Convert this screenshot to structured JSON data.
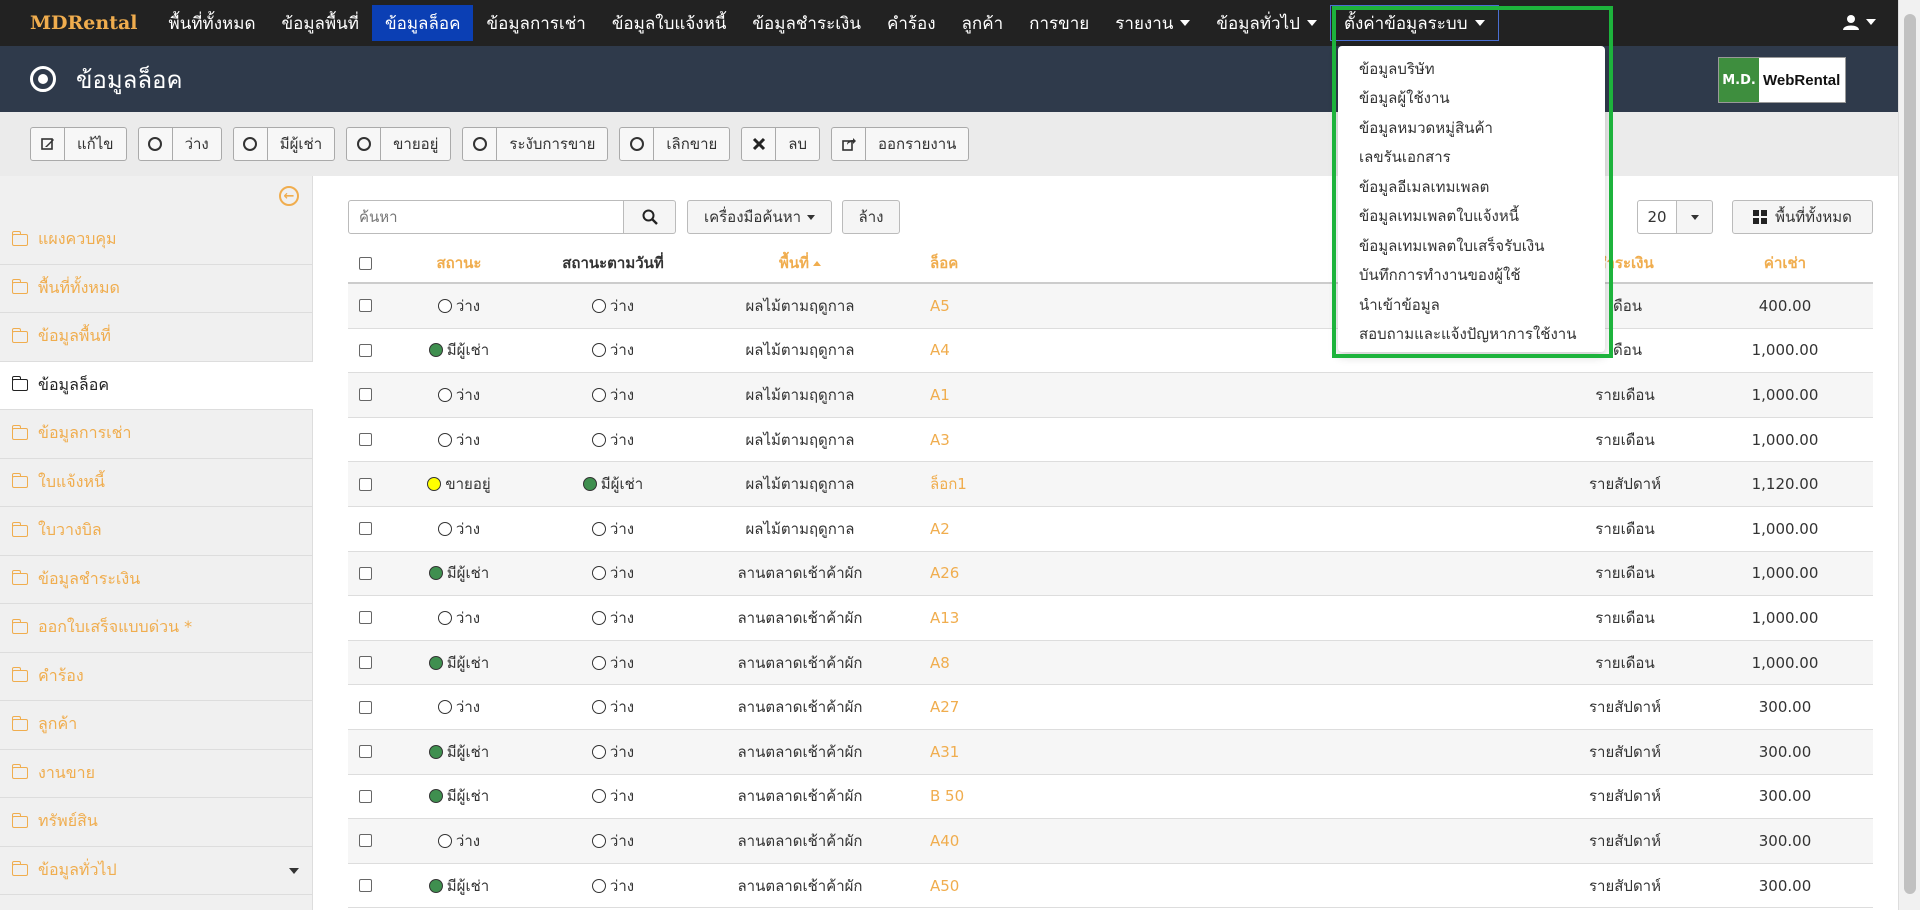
{
  "brand": "MDRental",
  "nav": [
    {
      "label": "พื้นที่ทั้งหมด",
      "dropdown": false
    },
    {
      "label": "ข้อมูลพื้นที่",
      "dropdown": false
    },
    {
      "label": "ข้อมูลล็อค",
      "dropdown": false,
      "active": true
    },
    {
      "label": "ข้อมูลการเช่า",
      "dropdown": false
    },
    {
      "label": "ข้อมูลใบแจ้งหนี้",
      "dropdown": false
    },
    {
      "label": "ข้อมูลชำระเงิน",
      "dropdown": false
    },
    {
      "label": "คำร้อง",
      "dropdown": false
    },
    {
      "label": "ลูกค้า",
      "dropdown": false
    },
    {
      "label": "การขาย",
      "dropdown": false
    },
    {
      "label": "รายงาน",
      "dropdown": true
    },
    {
      "label": "ข้อมูลทั่วไป",
      "dropdown": true
    },
    {
      "label": "ตั้งค่าข้อมูลระบบ",
      "dropdown": true,
      "open": true
    }
  ],
  "page_title": "ข้อมูลล็อค",
  "logo": {
    "left": "M.D.",
    "right": "WebRental"
  },
  "toolbar": [
    {
      "label": "แก้ไข",
      "icon": "edit-icon"
    },
    {
      "label": "ว่าง",
      "icon": "circle-icon"
    },
    {
      "label": "มีผู้เช่า",
      "icon": "circle-icon"
    },
    {
      "label": "ขายอยู่",
      "icon": "circle-icon"
    },
    {
      "label": "ระงับการขาย",
      "icon": "circle-icon"
    },
    {
      "label": "เลิกขาย",
      "icon": "circle-icon"
    },
    {
      "label": "ลบ",
      "icon": "close-icon"
    },
    {
      "label": "ออกรายงาน",
      "icon": "export-icon"
    }
  ],
  "sidebar": [
    {
      "label": "แผงควบคุม",
      "active": false
    },
    {
      "label": "พื้นที่ทั้งหมด",
      "active": false
    },
    {
      "label": "ข้อมูลพื้นที่",
      "active": false
    },
    {
      "label": "ข้อมูลล็อค",
      "active": true
    },
    {
      "label": "ข้อมูลการเช่า",
      "active": false
    },
    {
      "label": "ใบแจ้งหนี้",
      "active": false
    },
    {
      "label": "ใบวางบิล",
      "active": false
    },
    {
      "label": "ข้อมูลชำระเงิน",
      "active": false
    },
    {
      "label": "ออกใบเสร็จแบบด่วน *",
      "active": false
    },
    {
      "label": "คำร้อง",
      "active": false
    },
    {
      "label": "ลูกค้า",
      "active": false
    },
    {
      "label": "งานขาย",
      "active": false
    },
    {
      "label": "ทรัพย์สิน",
      "active": false
    },
    {
      "label": "ข้อมูลทั่วไป",
      "active": false
    }
  ],
  "search": {
    "placeholder": "ค้นหา"
  },
  "search_tools_label": "เครื่องมือค้นหา",
  "clear_label": "ล้าง",
  "page_size": "20",
  "all_areas_label": "พื้นที่ทั้งหมด",
  "table": {
    "headers": {
      "status": "สถานะ",
      "status_date": "สถานะตามวันที่",
      "area": "พื้นที่",
      "lock": "ล็อค",
      "payment": "ชำระเงิน",
      "rent": "ค่าเช่า"
    },
    "rows": [
      {
        "status": "ว่าง",
        "sdot": "empty",
        "status_date": "ว่าง",
        "ddot": "empty",
        "area": "ผลไม้ตามฤดูกาล",
        "lock": "A5",
        "payment": "เดือน",
        "rent": "400.00"
      },
      {
        "status": "มีผู้เช่า",
        "sdot": "green",
        "status_date": "ว่าง",
        "ddot": "empty",
        "area": "ผลไม้ตามฤดูกาล",
        "lock": "A4",
        "payment": "เดือน",
        "rent": "1,000.00"
      },
      {
        "status": "ว่าง",
        "sdot": "empty",
        "status_date": "ว่าง",
        "ddot": "empty",
        "area": "ผลไม้ตามฤดูกาล",
        "lock": "A1",
        "payment": "รายเดือน",
        "rent": "1,000.00"
      },
      {
        "status": "ว่าง",
        "sdot": "empty",
        "status_date": "ว่าง",
        "ddot": "empty",
        "area": "ผลไม้ตามฤดูกาล",
        "lock": "A3",
        "payment": "รายเดือน",
        "rent": "1,000.00"
      },
      {
        "status": "ขายอยู่",
        "sdot": "yellow",
        "status_date": "มีผู้เช่า",
        "ddot": "green",
        "area": "ผลไม้ตามฤดูกาล",
        "lock": "ล็อก1",
        "payment": "รายสัปดาห์",
        "rent": "1,120.00"
      },
      {
        "status": "ว่าง",
        "sdot": "empty",
        "status_date": "ว่าง",
        "ddot": "empty",
        "area": "ผลไม้ตามฤดูกาล",
        "lock": "A2",
        "payment": "รายเดือน",
        "rent": "1,000.00"
      },
      {
        "status": "มีผู้เช่า",
        "sdot": "green",
        "status_date": "ว่าง",
        "ddot": "empty",
        "area": "ลานตลาดเช้าค้าผัก",
        "lock": "A26",
        "payment": "รายเดือน",
        "rent": "1,000.00"
      },
      {
        "status": "ว่าง",
        "sdot": "empty",
        "status_date": "ว่าง",
        "ddot": "empty",
        "area": "ลานตลาดเช้าค้าผัก",
        "lock": "A13",
        "payment": "รายเดือน",
        "rent": "1,000.00"
      },
      {
        "status": "มีผู้เช่า",
        "sdot": "green",
        "status_date": "ว่าง",
        "ddot": "empty",
        "area": "ลานตลาดเช้าค้าผัก",
        "lock": "A8",
        "payment": "รายเดือน",
        "rent": "1,000.00"
      },
      {
        "status": "ว่าง",
        "sdot": "empty",
        "status_date": "ว่าง",
        "ddot": "empty",
        "area": "ลานตลาดเช้าค้าผัก",
        "lock": "A27",
        "payment": "รายสัปดาห์",
        "rent": "300.00"
      },
      {
        "status": "มีผู้เช่า",
        "sdot": "green",
        "status_date": "ว่าง",
        "ddot": "empty",
        "area": "ลานตลาดเช้าค้าผัก",
        "lock": "A31",
        "payment": "รายสัปดาห์",
        "rent": "300.00"
      },
      {
        "status": "มีผู้เช่า",
        "sdot": "green",
        "status_date": "ว่าง",
        "ddot": "empty",
        "area": "ลานตลาดเช้าค้าผัก",
        "lock": "B 50",
        "payment": "รายสัปดาห์",
        "rent": "300.00"
      },
      {
        "status": "ว่าง",
        "sdot": "empty",
        "status_date": "ว่าง",
        "ddot": "empty",
        "area": "ลานตลาดเช้าค้าผัก",
        "lock": "A40",
        "payment": "รายสัปดาห์",
        "rent": "300.00"
      },
      {
        "status": "มีผู้เช่า",
        "sdot": "green",
        "status_date": "ว่าง",
        "ddot": "empty",
        "area": "ลานตลาดเช้าค้าผัก",
        "lock": "A50",
        "payment": "รายสัปดาห์",
        "rent": "300.00"
      }
    ]
  },
  "dropdown": [
    "ข้อมูลบริษัท",
    "ข้อมูลผู้ใช้งาน",
    "ข้อมูลหมวดหมู่สินค้า",
    "เลขรันเอกสาร",
    "ข้อมูลอีเมลเทมเพลต",
    "ข้อมูลเทมเพลตใบแจ้งหนี้",
    "ข้อมูลเทมเพลตใบเสร็จรับเงิน",
    "บันทึกการทำงานของผู้ใช้",
    "นำเข้าข้อมูล",
    "สอบถามและแจ้งปัญหาการใช้งาน"
  ],
  "colors": {
    "accent": "#f0ad4e",
    "nav_active": "#0b3fb4",
    "highlight": "#1db33c",
    "header_bg": "#2f3a4b"
  }
}
